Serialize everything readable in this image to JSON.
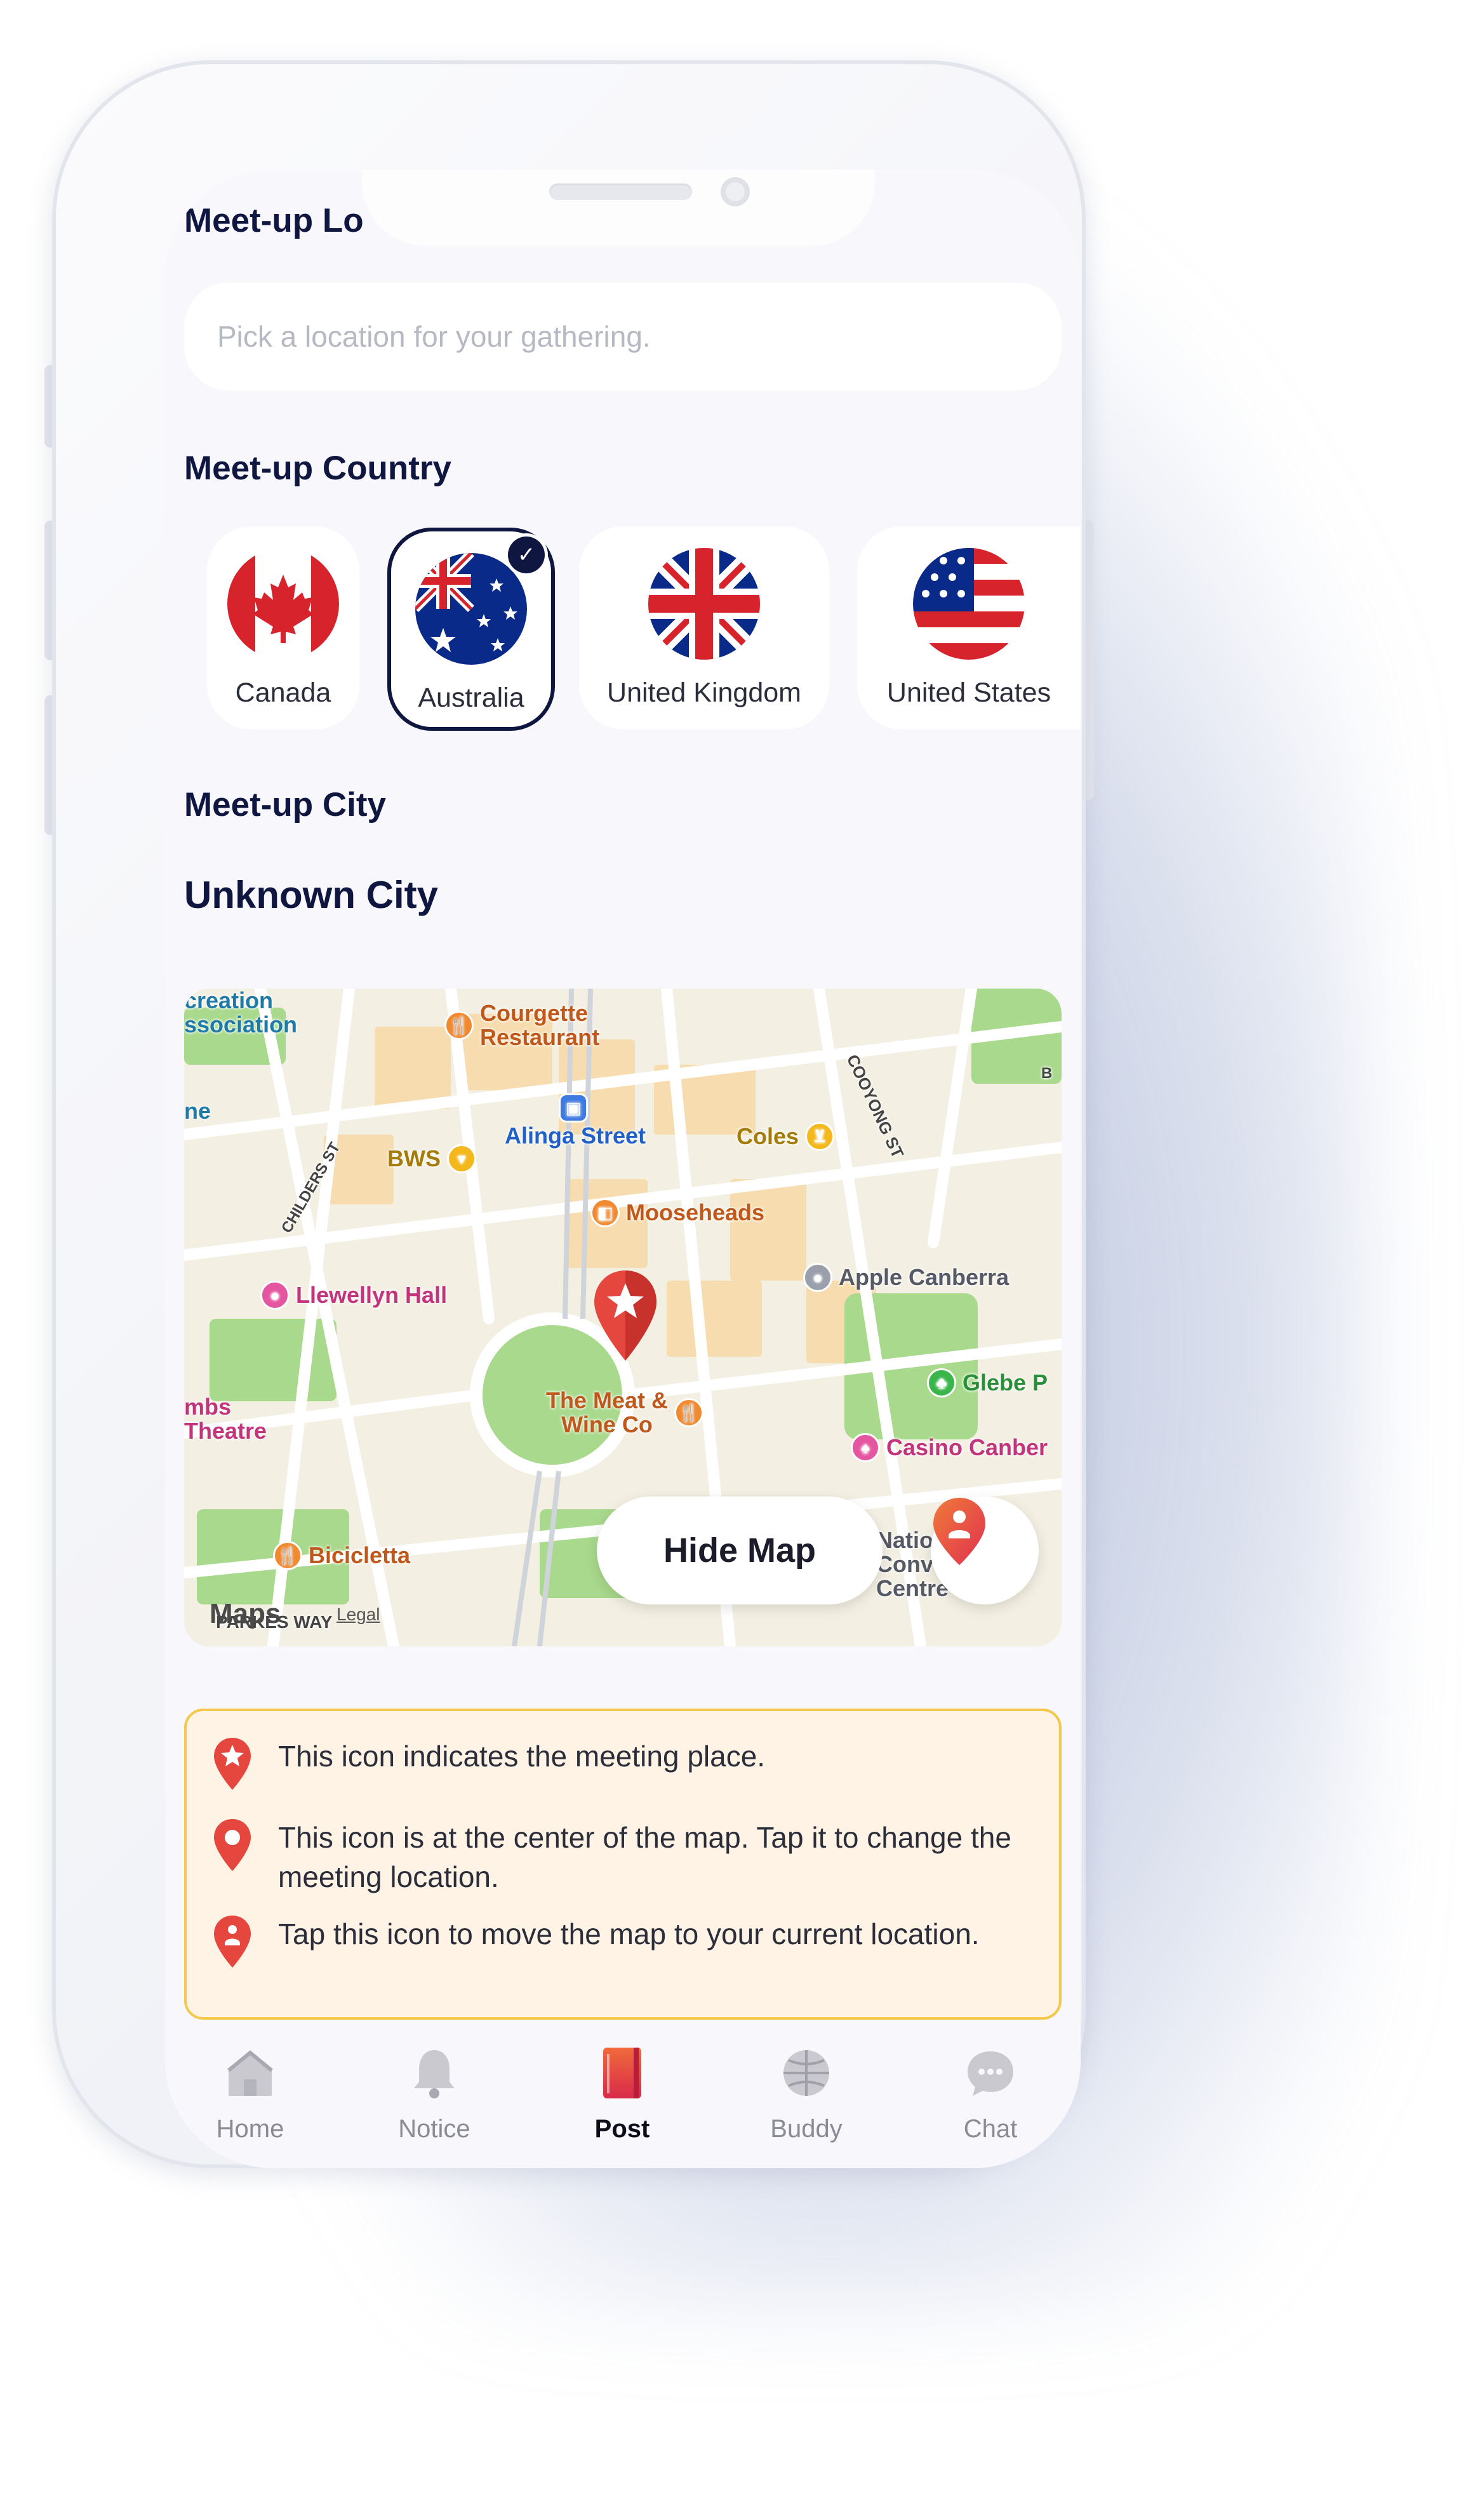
{
  "header": {
    "title": "Meet-up Lo"
  },
  "location": {
    "placeholder": "Pick a location for your gathering."
  },
  "country": {
    "title": "Meet-up Country",
    "items": [
      {
        "label": "Canada",
        "icon": "canada-flag-icon",
        "selected": false
      },
      {
        "label": "Australia",
        "icon": "australia-flag-icon",
        "selected": true
      },
      {
        "label": "United Kingdom",
        "icon": "uk-flag-icon",
        "selected": false
      },
      {
        "label": "United States",
        "icon": "us-flag-icon",
        "selected": false
      }
    ],
    "check_glyph": "✓"
  },
  "city": {
    "title": "Meet-up City",
    "value": "Unknown City"
  },
  "map": {
    "pois": [
      {
        "label": "creation\nssociation"
      },
      {
        "label": "Courgette\nRestaurant"
      },
      {
        "label": "Alinga Street"
      },
      {
        "label": "BWS"
      },
      {
        "label": "Coles"
      },
      {
        "label": "Mooseheads"
      },
      {
        "label": "Apple Canberra"
      },
      {
        "label": "Llewellyn Hall"
      },
      {
        "label": "Glebe P"
      },
      {
        "label": "The Meat &\nWine Co"
      },
      {
        "label": "mbs\nTheatre"
      },
      {
        "label": "Casino Canber"
      },
      {
        "label": "Bicicletta"
      },
      {
        "label": "Natio\nConv\nCentre"
      },
      {
        "label": "ne"
      }
    ],
    "streets": [
      "CHILDERS ST",
      "COOYONG ST",
      "PARKES WAY",
      "B"
    ],
    "hide_label": "Hide Map",
    "logo": "Maps",
    "legal": "Legal"
  },
  "legend": {
    "items": [
      {
        "icon": "star-pin-icon",
        "text": "This icon indicates the meeting place."
      },
      {
        "icon": "center-pin-icon",
        "text": "This icon is at the center of the map. Tap it to change the meeting location."
      },
      {
        "icon": "person-pin-icon",
        "text": "Tap this icon to move the map to your current location."
      }
    ]
  },
  "tabs": [
    {
      "label": "Home",
      "icon": "home-icon",
      "active": false
    },
    {
      "label": "Notice",
      "icon": "bell-icon",
      "active": false
    },
    {
      "label": "Post",
      "icon": "notebook-icon",
      "active": true
    },
    {
      "label": "Buddy",
      "icon": "globe-icon",
      "active": false
    },
    {
      "label": "Chat",
      "icon": "chat-bubble-icon",
      "active": false
    }
  ],
  "colors": {
    "accent": "#0f1640",
    "pin": "#e5473f",
    "legend_bg": "#fff3e5",
    "legend_border": "#f3c84b"
  }
}
